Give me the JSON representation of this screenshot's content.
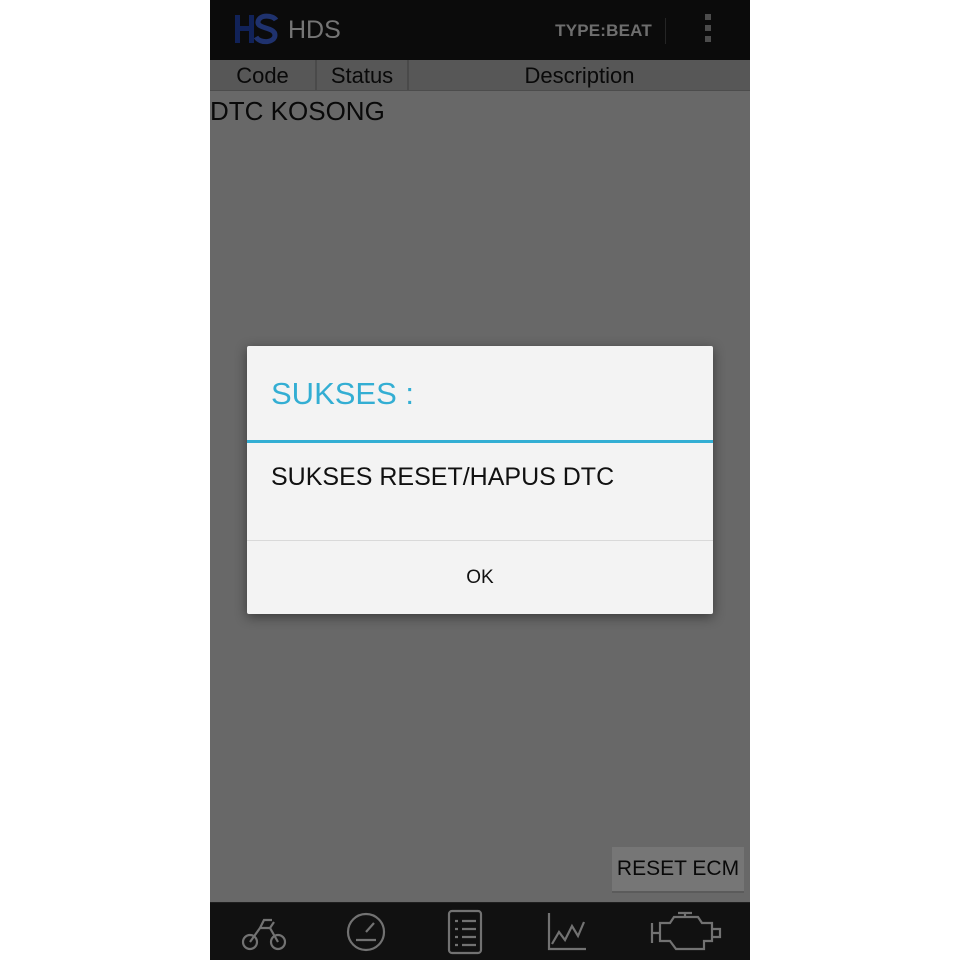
{
  "app": {
    "title": "HDS",
    "type_label": "TYPE:BEAT"
  },
  "table": {
    "headers": [
      "Code",
      "Status",
      "Description"
    ],
    "empty_message": "DTC KOSONG"
  },
  "actions": {
    "reset_ecm_label": "RESET ECM"
  },
  "dialog": {
    "title": "SUKSES :",
    "message": "SUKSES RESET/HAPUS DTC",
    "ok_label": "OK"
  },
  "bottom_nav": [
    {
      "icon": "motorcycle-icon"
    },
    {
      "icon": "speedometer-icon"
    },
    {
      "icon": "list-icon"
    },
    {
      "icon": "graph-icon"
    },
    {
      "icon": "engine-icon"
    }
  ],
  "colors": {
    "accent": "#33aed3",
    "actionbar": "#151515",
    "logo": "#1f3fa0"
  }
}
